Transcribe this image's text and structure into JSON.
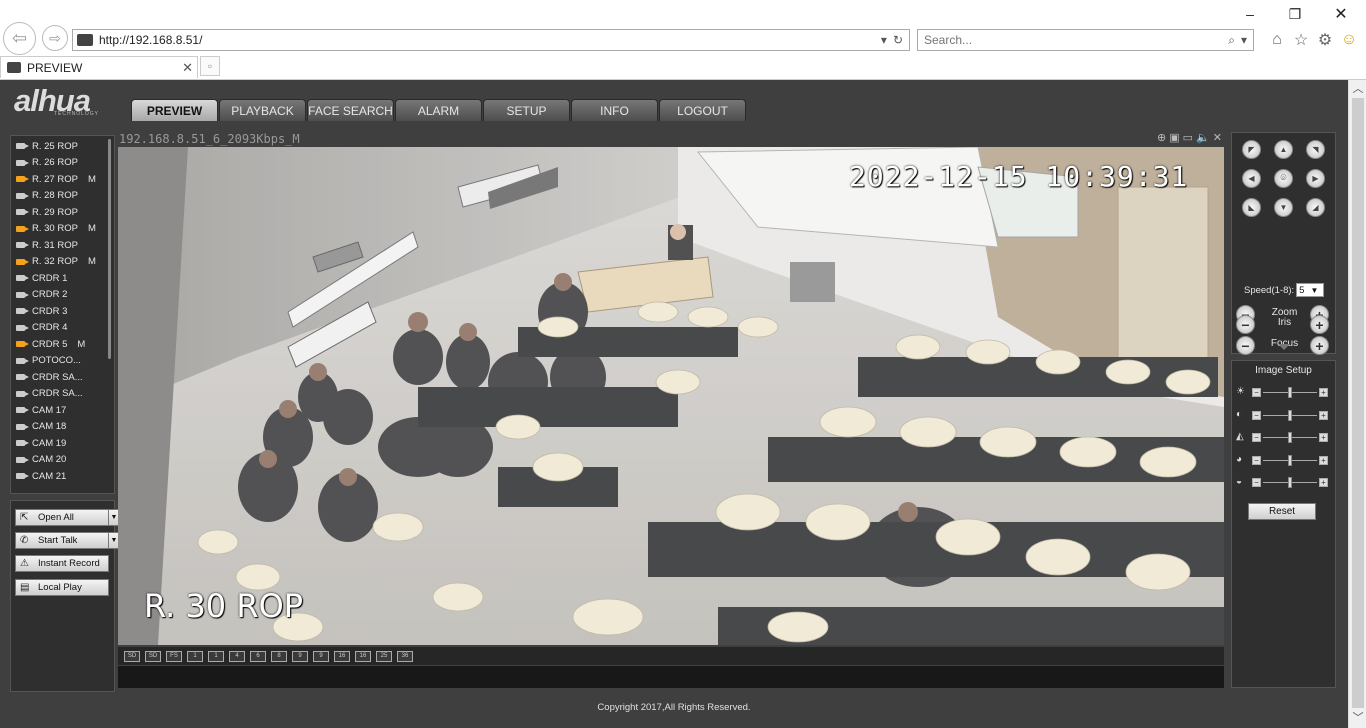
{
  "browser": {
    "url": "http://192.168.8.51/",
    "search_placeholder": "Search...",
    "tab_title": "PREVIEW"
  },
  "app": {
    "nav_tabs": [
      "PREVIEW",
      "PLAYBACK",
      "FACE SEARCH",
      "ALARM",
      "SETUP",
      "INFO",
      "LOGOUT"
    ],
    "active_tab": "PREVIEW",
    "footer": "Copyright 2017,All Rights Reserved."
  },
  "cameras": [
    {
      "name": "R. 25 ROP",
      "active": false,
      "flag": ""
    },
    {
      "name": "R. 26 ROP",
      "active": false,
      "flag": ""
    },
    {
      "name": "R. 27 ROP",
      "active": true,
      "flag": "M"
    },
    {
      "name": "R. 28 ROP",
      "active": false,
      "flag": ""
    },
    {
      "name": "R. 29 ROP",
      "active": false,
      "flag": ""
    },
    {
      "name": "R. 30 ROP",
      "active": true,
      "flag": "M"
    },
    {
      "name": "R. 31 ROP",
      "active": false,
      "flag": ""
    },
    {
      "name": "R. 32 ROP",
      "active": true,
      "flag": "M"
    },
    {
      "name": "CRDR 1",
      "active": false,
      "flag": ""
    },
    {
      "name": "CRDR 2",
      "active": false,
      "flag": ""
    },
    {
      "name": "CRDR 3",
      "active": false,
      "flag": ""
    },
    {
      "name": "CRDR 4",
      "active": false,
      "flag": ""
    },
    {
      "name": "CRDR 5",
      "active": true,
      "flag": "M"
    },
    {
      "name": "POTOCO...",
      "active": false,
      "flag": ""
    },
    {
      "name": "CRDR SA...",
      "active": false,
      "flag": ""
    },
    {
      "name": "CRDR SA...",
      "active": false,
      "flag": ""
    },
    {
      "name": "CAM 17",
      "active": false,
      "flag": ""
    },
    {
      "name": "CAM 18",
      "active": false,
      "flag": ""
    },
    {
      "name": "CAM 19",
      "active": false,
      "flag": ""
    },
    {
      "name": "CAM 20",
      "active": false,
      "flag": ""
    },
    {
      "name": "CAM 21",
      "active": false,
      "flag": ""
    }
  ],
  "actions": {
    "open_all": "Open All",
    "start_talk": "Start Talk",
    "instant_record": "Instant Record",
    "local_play": "Local Play"
  },
  "video": {
    "stream_title": "192.168.8.51_6_2093Kbps_M",
    "timestamp": "2022-12-15 10:39:31",
    "channel_label": "R. 30 ROP"
  },
  "layout_buttons": [
    "SD",
    "SD",
    "FS",
    "1",
    "1",
    "4",
    "6",
    "8",
    "9",
    "9",
    "16",
    "16",
    "25",
    "36"
  ],
  "ptz": {
    "speed_label": "Speed(1-8):",
    "speed_value": "5",
    "zoom_label": "Zoom",
    "focus_label": "Focus",
    "iris_label": "Iris"
  },
  "image_setup": {
    "title": "Image Setup",
    "reset_label": "Reset",
    "sliders": [
      {
        "icon": "brightness-icon",
        "value": 0.5
      },
      {
        "icon": "contrast-icon",
        "value": 0.5
      },
      {
        "icon": "saturation-icon",
        "value": 0.5
      },
      {
        "icon": "hue-icon",
        "value": 0.5
      },
      {
        "icon": "sharpness-icon",
        "value": 0.5
      }
    ]
  }
}
